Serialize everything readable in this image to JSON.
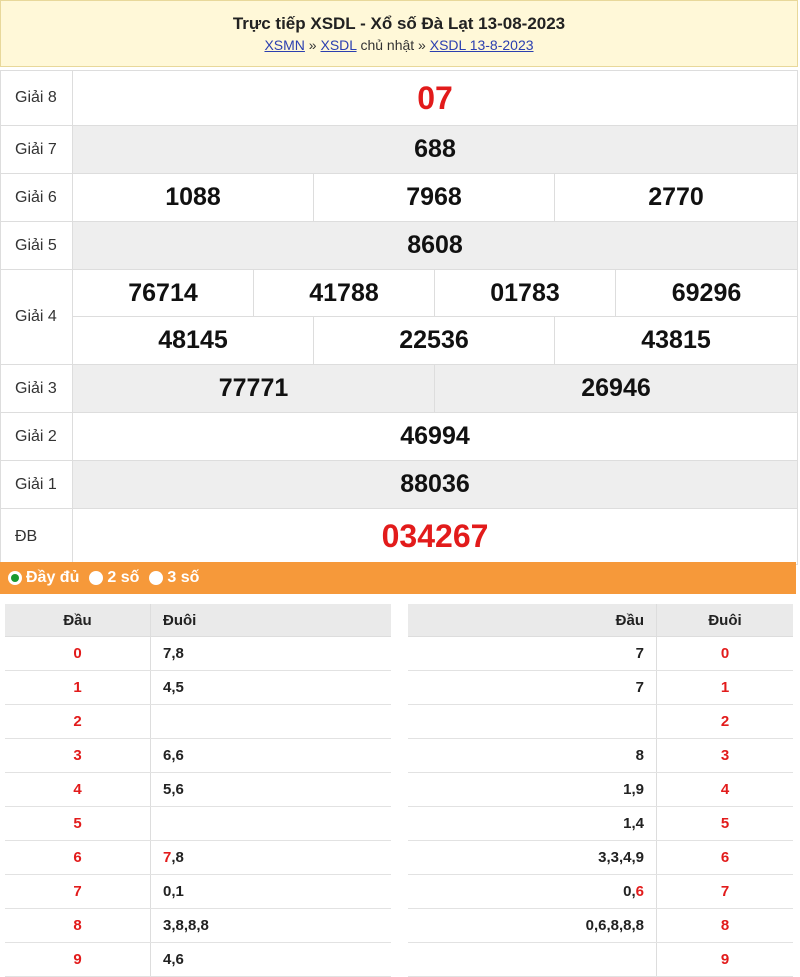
{
  "header": {
    "title": "Trực tiếp XSDL - Xổ số Đà Lạt 13-08-2023",
    "crumb1": "XSMN",
    "sep1": " » ",
    "crumb2": "XSDL",
    "crumb2_suffix": " chủ nhật",
    "sep2": " » ",
    "crumb3": "XSDL 13-8-2023"
  },
  "prizes": {
    "g8": {
      "label": "Giải 8",
      "values": [
        "07"
      ]
    },
    "g7": {
      "label": "Giải 7",
      "values": [
        "688"
      ]
    },
    "g6": {
      "label": "Giải 6",
      "values": [
        "1088",
        "7968",
        "2770"
      ]
    },
    "g5": {
      "label": "Giải 5",
      "values": [
        "8608"
      ]
    },
    "g4": {
      "label": "Giải 4",
      "values": [
        "76714",
        "41788",
        "01783",
        "69296",
        "48145",
        "22536",
        "43815"
      ]
    },
    "g3": {
      "label": "Giải 3",
      "values": [
        "77771",
        "26946"
      ]
    },
    "g2": {
      "label": "Giải 2",
      "values": [
        "46994"
      ]
    },
    "g1": {
      "label": "Giải 1",
      "values": [
        "88036"
      ]
    },
    "db": {
      "label": "ĐB",
      "values": [
        "034267"
      ]
    }
  },
  "options": {
    "full": "Đầy đủ",
    "two": "2 số",
    "three": "3 số",
    "selected": "full"
  },
  "loto_left": {
    "head_label": "Đầu",
    "tail_label": "Đuôi",
    "rows": [
      {
        "head": "0",
        "tail": "7,8"
      },
      {
        "head": "1",
        "tail": "4,5"
      },
      {
        "head": "2",
        "tail": ""
      },
      {
        "head": "3",
        "tail": "6,6"
      },
      {
        "head": "4",
        "tail": "5,6"
      },
      {
        "head": "5",
        "tail": ""
      },
      {
        "head": "6",
        "tail_red": "7",
        "tail": ",8"
      },
      {
        "head": "7",
        "tail": "0,1"
      },
      {
        "head": "8",
        "tail": "3,8,8,8"
      },
      {
        "head": "9",
        "tail": "4,6"
      }
    ]
  },
  "loto_right": {
    "head_label": "Đầu",
    "tail_label": "Đuôi",
    "rows": [
      {
        "head": "7",
        "tail": "0"
      },
      {
        "head": "7",
        "tail": "1"
      },
      {
        "head": "",
        "tail": "2"
      },
      {
        "head": "8",
        "tail": "3"
      },
      {
        "head": "1,9",
        "tail": "4"
      },
      {
        "head": "1,4",
        "tail": "5"
      },
      {
        "head": "3,3,4,9",
        "tail": "6"
      },
      {
        "head": "0,",
        "head_red": "6",
        "tail": "7"
      },
      {
        "head": "0,6,8,8,8",
        "tail": "8"
      },
      {
        "head": "",
        "tail": "9"
      }
    ]
  },
  "colors": {
    "accent_red": "#e21b1b",
    "orange_bar": "#f6993a",
    "header_bg": "#fff8d8",
    "link": "#2b3fb0",
    "radio_green": "#1a9a2e"
  }
}
